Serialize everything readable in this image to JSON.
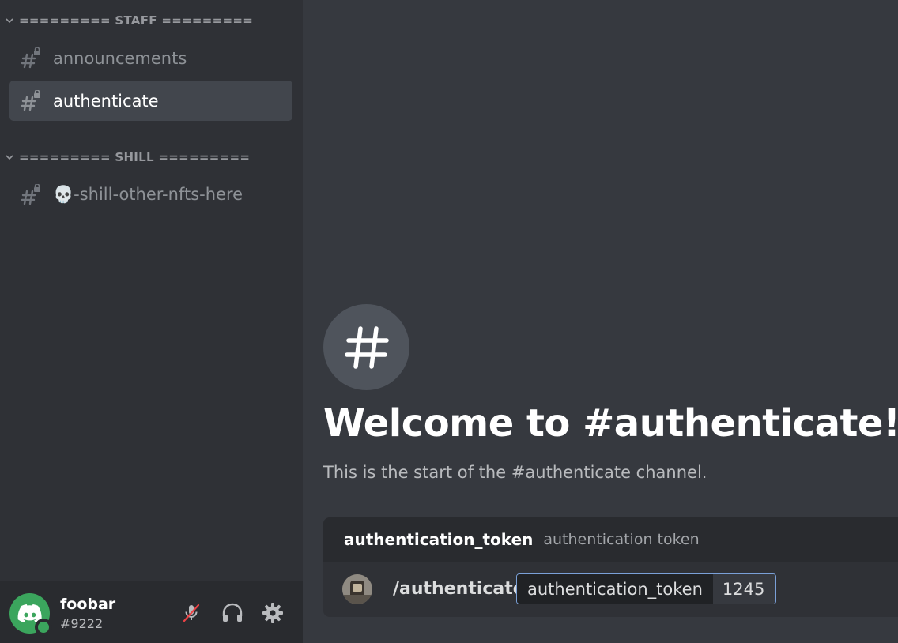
{
  "sidebar": {
    "categories": [
      {
        "label": "========= STAFF ========="
      },
      {
        "label": "========= SHILL ========="
      }
    ],
    "channels": [
      {
        "name": "announcements",
        "locked": true,
        "active": false
      },
      {
        "name": "authenticate",
        "locked": true,
        "active": true
      },
      {
        "name": "💀-shill-other-nfts-here",
        "locked": true,
        "active": false
      }
    ]
  },
  "user_panel": {
    "username": "foobar",
    "discriminator": "#9222",
    "status": "online",
    "controls": [
      "microphone-muted-icon",
      "headphones-icon",
      "settings-gear-icon"
    ]
  },
  "main": {
    "welcome_title": "Welcome to #authenticate!",
    "welcome_subtitle": "This is the start of the #authenticate channel.",
    "command_option": {
      "name": "authentication_token",
      "description": "authentication token"
    },
    "command": {
      "name": "/authenticate",
      "param_key": "authentication_token",
      "param_value": "1245"
    }
  },
  "colors": {
    "sidebar_bg": "#2f3136",
    "main_bg": "#36393f",
    "online": "#3ba55d",
    "accent_border": "#7aa0d8"
  }
}
